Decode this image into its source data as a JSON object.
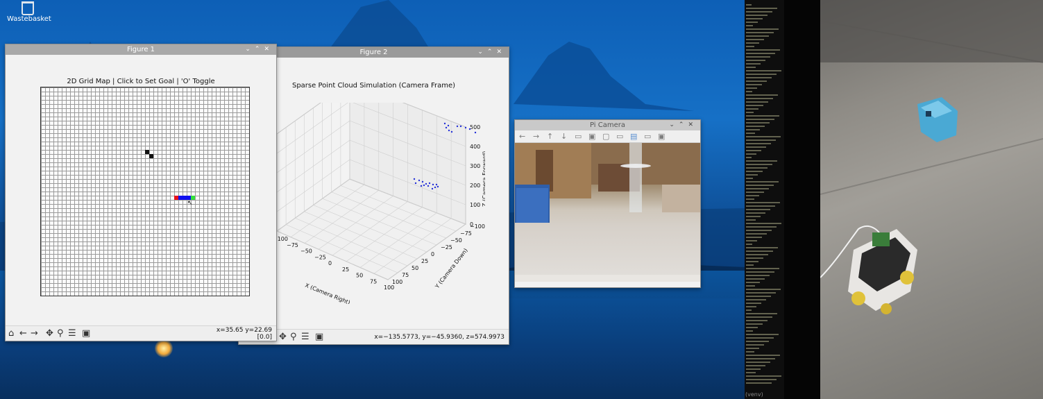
{
  "desktop": {
    "trash_label": "Wastebasket"
  },
  "figure1": {
    "window_title": "Figure 1",
    "plot_title": "2D Grid Map | Click to Set Goal | 'O' Toggle",
    "coords": "x=35.65 y=22.69",
    "pixel_value": "[0.0]",
    "grid": {
      "size": 50,
      "obstacle_cells": [
        [
          25,
          15
        ],
        [
          26,
          16
        ]
      ],
      "path_cells": [
        [
          32,
          26
        ],
        [
          33,
          26
        ],
        [
          34,
          26
        ],
        [
          35,
          26
        ],
        [
          36,
          26
        ]
      ],
      "start_color": "#e8141b",
      "path_color": "#1010f0",
      "goal_color": "#35e03c",
      "obstacle_color": "#111111"
    }
  },
  "figure2": {
    "window_title": "Figure 2",
    "plot_title": "Sparse Point Cloud Simulation (Camera Frame)",
    "coords": "x=−135.5773, y=−45.9360, z=574.9973",
    "chart_data": {
      "type": "scatter",
      "xlabel": "X (Camera Right)",
      "ylabel": "Y (Camera Down)",
      "zlabel": "Z (Camera Forward)",
      "x_ticks": [
        "−100",
        "−75",
        "−50",
        "−25",
        "0",
        "25",
        "50",
        "75",
        "100"
      ],
      "y_ticks": [
        "−100",
        "−75",
        "−50",
        "−25",
        "0",
        "25",
        "50",
        "75",
        "100"
      ],
      "z_ticks": [
        "0",
        "100",
        "200",
        "300",
        "400",
        "500"
      ],
      "point_color": "#2430d8"
    }
  },
  "picam": {
    "window_title": "Pi Camera"
  },
  "terminal": {
    "footer": "(venv)"
  },
  "toolbar_icons": [
    "home-icon",
    "back-icon",
    "forward-icon",
    "pan-icon",
    "zoom-icon",
    "configure-icon",
    "save-icon"
  ]
}
